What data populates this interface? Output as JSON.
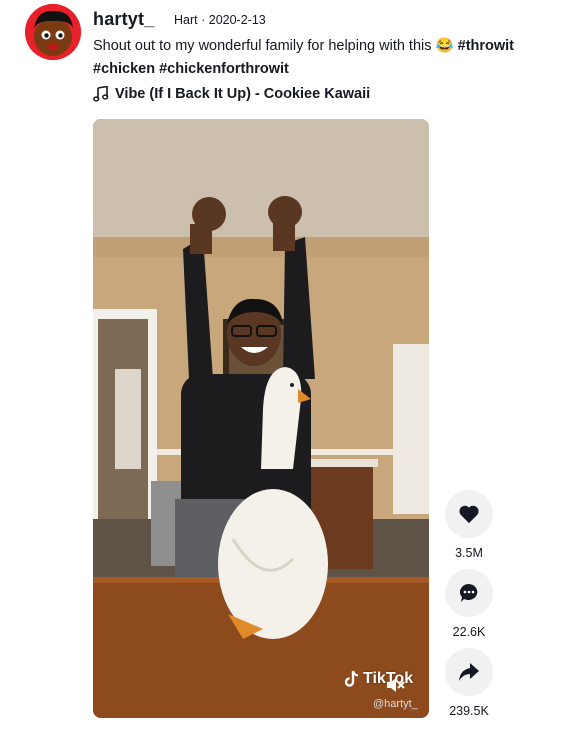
{
  "post": {
    "username": "hartyt_",
    "display_name": "Hart",
    "date": "2020-2-13",
    "caption_text": "Shout out to my wonderful family for helping with this",
    "caption_emoji": "😂",
    "hashtags": [
      "#throwit",
      "#chicken",
      "#chickenforthrowit"
    ],
    "music": "Vibe (If I Back It Up) - Cookiee Kawaii"
  },
  "video": {
    "watermark_brand": "TikTok",
    "watermark_user": "@hartyt_"
  },
  "actions": {
    "likes": "3.5M",
    "comments": "22.6K",
    "shares": "239.5K"
  },
  "colors": {
    "avatar_bg": "#e8202a",
    "action_bg": "#f1f1f2"
  },
  "icons": [
    "music-note-icon",
    "heart-icon",
    "comment-icon",
    "share-icon",
    "mute-icon",
    "tiktok-logo-icon"
  ]
}
